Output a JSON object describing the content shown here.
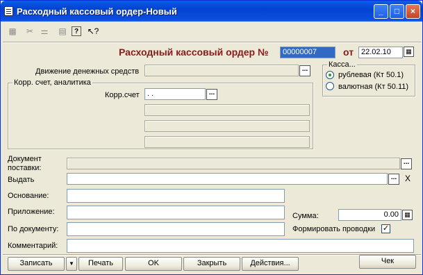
{
  "window": {
    "title": "Расходный кассовый ордер-Новый",
    "controls": [
      "_",
      "□",
      "×"
    ]
  },
  "toolbar": {
    "icons": [
      "doc-props-icon",
      "cut-icon",
      "structure-icon",
      "grid-icon",
      "help-icon",
      "pointer-help-icon"
    ],
    "glyphs": [
      "▦",
      "✂",
      "⚌",
      "▤",
      "?",
      "↖?"
    ]
  },
  "header": {
    "title": "Расходный кассовый ордер №",
    "number": "00000007",
    "date_label": "от",
    "date": "22.02.10"
  },
  "movement": {
    "label": "Движение денежных средств",
    "value": ""
  },
  "corr": {
    "group_title": "Корр. счет, аналитика",
    "account_label": "Корр.счет",
    "account_value": " .  .",
    "analytic1": "",
    "analytic2": "",
    "analytic3": ""
  },
  "kassa": {
    "group_title": "Касса...",
    "option_rub": "рублевая (Кт 50.1)",
    "option_val": "валютная (Кт 50.11)",
    "selected": "рублевая (Кт 50.1)"
  },
  "form": {
    "doc_label_1": "Документ",
    "doc_label_2": "поставки:",
    "issue_label": "Выдать",
    "basis_label": "Основание:",
    "attachment_label": "Приложение:",
    "bydoc_label": "По документу:",
    "comment_label": "Комментарий:",
    "sum_label": "Сумма:",
    "sum_value": "0.00",
    "postings_label": "Формировать проводки",
    "postings_checked": true,
    "dots": "...",
    "clear": "X"
  },
  "buttons": {
    "save": "Записать",
    "menu": "▼",
    "print": "Печать",
    "ok": "OK",
    "close": "Закрыть",
    "actions": "Действия...",
    "check": "Чек"
  }
}
